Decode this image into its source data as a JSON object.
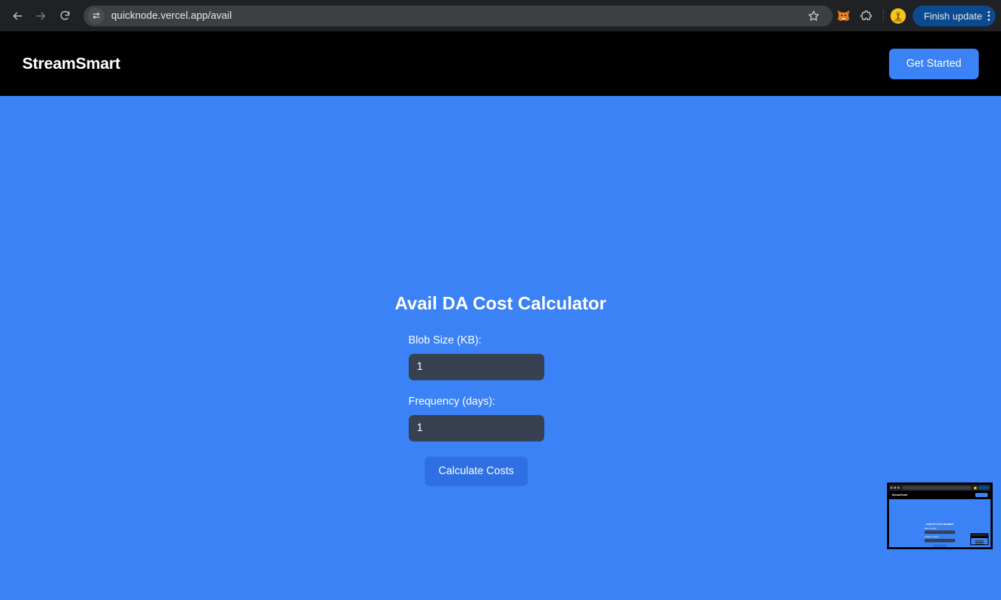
{
  "browser": {
    "back_icon": "arrow-left-icon",
    "forward_icon": "arrow-right-icon",
    "reload_icon": "reload-icon",
    "site_settings_icon": "tune-sliders-icon",
    "url": "quicknode.vercel.app/avail",
    "bookmark_icon": "star-icon",
    "metamask_icon": "metamask-fox-icon",
    "extensions_icon": "puzzle-piece-icon",
    "profile_icon": "profile-avatar-icon",
    "update_label": "Finish update",
    "menu_icon": "kebab-menu-icon"
  },
  "site_header": {
    "brand": "StreamSmart",
    "cta_label": "Get Started"
  },
  "calculator": {
    "title": "Avail DA Cost Calculator",
    "blob_label": "Blob Size (KB):",
    "blob_value": "1",
    "frequency_label": "Frequency (days):",
    "frequency_value": "1",
    "submit_label": "Calculate Costs"
  },
  "pip": {
    "brand": "StreamSmart",
    "title": "Avail DA Cost Calculator",
    "blob_label": "Blob Size (KB):",
    "blob_value": "1",
    "frequency_label": "Frequency (days):",
    "frequency_value": "1"
  },
  "colors": {
    "page_background": "#3b82f6",
    "header_background": "#000000",
    "input_background": "#374151",
    "button_blue": "#2f6fe4",
    "accent_blue": "#3b82f6",
    "chrome_background": "#202124",
    "url_pill": "#3c4043",
    "update_button": "#0b4a8f",
    "avatar_yellow": "#f5c518"
  }
}
